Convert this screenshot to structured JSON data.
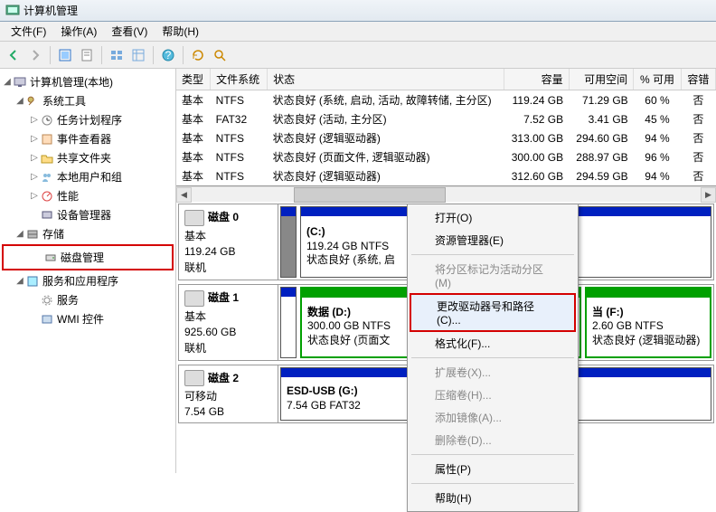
{
  "window": {
    "title": "计算机管理"
  },
  "menubar": {
    "file": "文件(F)",
    "action": "操作(A)",
    "view": "查看(V)",
    "help": "帮助(H)"
  },
  "tree": {
    "root": "计算机管理(本地)",
    "system_tools": "系统工具",
    "task_scheduler": "任务计划程序",
    "event_viewer": "事件查看器",
    "shared_folders": "共享文件夹",
    "local_users": "本地用户和组",
    "performance": "性能",
    "device_manager": "设备管理器",
    "storage": "存储",
    "disk_management": "磁盘管理",
    "services_apps": "服务和应用程序",
    "services": "服务",
    "wmi_control": "WMI 控件"
  },
  "columns": {
    "type": "类型",
    "fs": "文件系统",
    "status": "状态",
    "capacity": "容量",
    "available": "可用空间",
    "pct_free": "% 可用",
    "fault": "容错"
  },
  "volumes": [
    {
      "type": "基本",
      "fs": "NTFS",
      "status": "状态良好 (系统, 启动, 活动, 故障转储, 主分区)",
      "capacity": "119.24 GB",
      "available": "71.29 GB",
      "pct_free": "60 %",
      "fault": "否"
    },
    {
      "type": "基本",
      "fs": "FAT32",
      "status": "状态良好 (活动, 主分区)",
      "capacity": "7.52 GB",
      "available": "3.41 GB",
      "pct_free": "45 %",
      "fault": "否"
    },
    {
      "type": "基本",
      "fs": "NTFS",
      "status": "状态良好 (逻辑驱动器)",
      "capacity": "313.00 GB",
      "available": "294.60 GB",
      "pct_free": "94 %",
      "fault": "否"
    },
    {
      "type": "基本",
      "fs": "NTFS",
      "status": "状态良好 (页面文件, 逻辑驱动器)",
      "capacity": "300.00 GB",
      "available": "288.97 GB",
      "pct_free": "96 %",
      "fault": "否"
    },
    {
      "type": "基本",
      "fs": "NTFS",
      "status": "状态良好 (逻辑驱动器)",
      "capacity": "312.60 GB",
      "available": "294.59 GB",
      "pct_free": "94 %",
      "fault": "否"
    }
  ],
  "disks": {
    "d0": {
      "name": "磁盘 0",
      "type": "基本",
      "size": "119.24 GB",
      "status": "联机",
      "p0": {
        "name": "(C:)",
        "size": "119.24 GB NTFS",
        "status": "状态良好 (系统, 启"
      }
    },
    "d1": {
      "name": "磁盘 1",
      "type": "基本",
      "size": "925.60 GB",
      "status": "联机",
      "p0": {
        "name": "数据  (D:)",
        "size": "300.00 GB NTFS",
        "status": "状态良好 (页面文"
      },
      "p1": {
        "name": "当  (F:)",
        "size": "2.60 GB NTFS",
        "status": "状态良好 (逻辑驱动器)"
      }
    },
    "d2": {
      "name": "磁盘 2",
      "type": "可移动",
      "size": "7.54 GB",
      "p0": {
        "name": "ESD-USB  (G:)",
        "size": "7.54 GB FAT32"
      }
    }
  },
  "context_menu": {
    "open": "打开(O)",
    "explorer": "资源管理器(E)",
    "mark_active": "将分区标记为活动分区(M)",
    "change_drive": "更改驱动器号和路径(C)...",
    "format": "格式化(F)...",
    "extend": "扩展卷(X)...",
    "shrink": "压缩卷(H)...",
    "add_mirror": "添加镜像(A)...",
    "delete": "删除卷(D)...",
    "properties": "属性(P)",
    "help": "帮助(H)"
  }
}
